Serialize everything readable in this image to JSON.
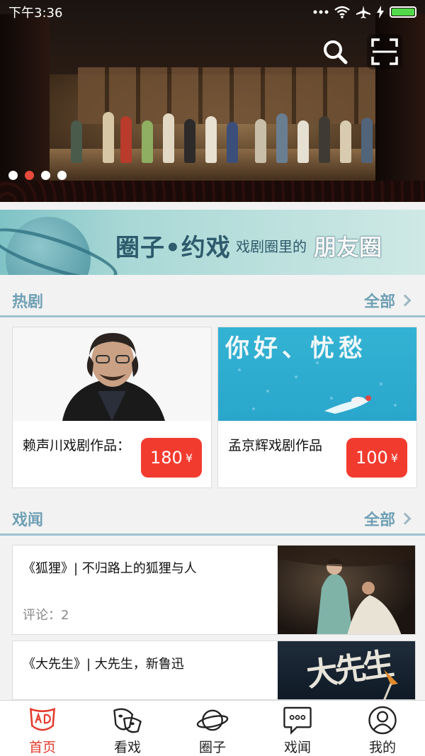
{
  "status_bar": {
    "time": "下午3:36",
    "icons": [
      "more-dots-icon",
      "wifi-icon",
      "airplane-icon",
      "charging-icon",
      "battery-icon"
    ],
    "battery_color": "#52d94b"
  },
  "hero": {
    "slides": 4,
    "active_slide_index": 1,
    "search_icon": "search-icon",
    "scan_icon": "scan-icon",
    "active_dot_color": "#e84a3c"
  },
  "banner": {
    "title": "圈子•约戏",
    "subtitle": "戏剧圈里的",
    "emphasis": "朋友圈"
  },
  "hot": {
    "title": "热剧",
    "more_label": "全部",
    "items": [
      {
        "name": "赖声川戏剧作品：",
        "price": "180",
        "currency": "¥"
      },
      {
        "name": "孟京辉戏剧作品",
        "price": "100",
        "currency": "¥",
        "poster_text": "你好、忧愁"
      }
    ]
  },
  "news": {
    "title": "戏闻",
    "more_label": "全部",
    "items": [
      {
        "title": "《狐狸》| 不归路上的狐狸与人",
        "comments": "评论：2"
      },
      {
        "title": "《大先生》| 大先生，新鲁迅",
        "poster_text": "大先生"
      }
    ]
  },
  "tabbar": {
    "active_color": "#e33a2c",
    "items": [
      {
        "label": "首页",
        "icon": "home-mask-icon",
        "active": true
      },
      {
        "label": "看戏",
        "icon": "theater-mask-icon",
        "active": false
      },
      {
        "label": "圈子",
        "icon": "planet-icon",
        "active": false
      },
      {
        "label": "戏闻",
        "icon": "chat-bubble-icon",
        "active": false
      },
      {
        "label": "我的",
        "icon": "user-icon",
        "active": false
      }
    ]
  },
  "colors": {
    "accent": "#6fa0b4",
    "price_bg": "#f23b2f"
  }
}
